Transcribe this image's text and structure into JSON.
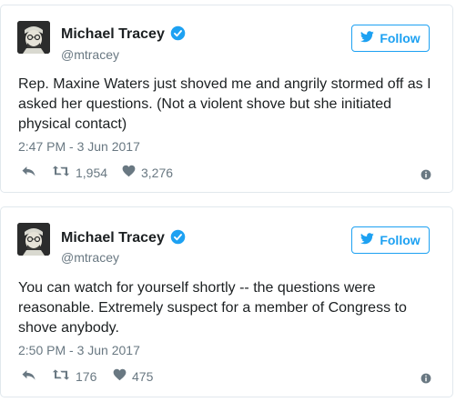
{
  "tweets": [
    {
      "name": "Michael Tracey",
      "handle": "@mtracey",
      "follow_label": "Follow",
      "text": "Rep. Maxine Waters just shoved me and angrily stormed off as I asked her questions. (Not a violent shove but she initiated physical contact)",
      "timestamp": "2:47 PM - 3 Jun 2017",
      "retweets": "1,954",
      "likes": "3,276"
    },
    {
      "name": "Michael Tracey",
      "handle": "@mtracey",
      "follow_label": "Follow",
      "text": "You can watch for yourself shortly -- the questions were reasonable. Extremely suspect for a member of Congress to shove anybody.",
      "timestamp": "2:50 PM - 3 Jun 2017",
      "retweets": "176",
      "likes": "475"
    }
  ],
  "colors": {
    "accent": "#1da1f2",
    "text": "#1c2022",
    "muted": "#697882",
    "border": "#e1e8ed"
  },
  "icons": [
    "avatar",
    "verified-icon",
    "twitter-bird-icon",
    "reply-icon",
    "retweet-icon",
    "heart-icon",
    "info-icon"
  ]
}
